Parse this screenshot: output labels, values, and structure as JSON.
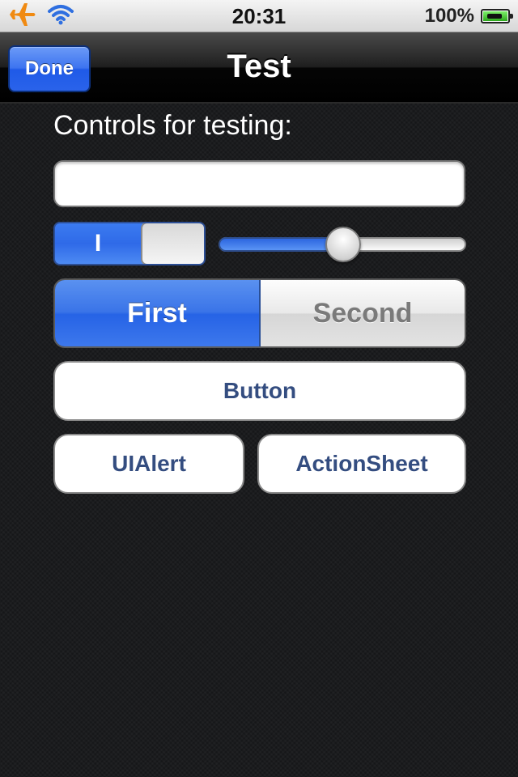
{
  "status_bar": {
    "time": "20:31",
    "battery_percent": "100%",
    "battery_level": 1.0,
    "icons": [
      "airplane-icon",
      "wifi-icon",
      "battery-icon"
    ],
    "airplane_color": "#f08a12",
    "wifi_color": "#2f6fe0"
  },
  "nav_bar": {
    "title": "Test",
    "done_label": "Done"
  },
  "content": {
    "section_label": "Controls for testing:",
    "text_field": {
      "value": "",
      "placeholder": ""
    },
    "switch": {
      "state": "on",
      "on_label": "I"
    },
    "slider": {
      "value": 0.5
    },
    "segmented": {
      "segments": [
        "First",
        "Second"
      ],
      "selected_index": 0
    },
    "buttons": {
      "main": "Button",
      "alert": "UIAlert",
      "action_sheet": "ActionSheet"
    }
  },
  "colors": {
    "accent_blue": "#2f6ae8",
    "button_text": "#344d80",
    "background": "#1b1c1e"
  }
}
